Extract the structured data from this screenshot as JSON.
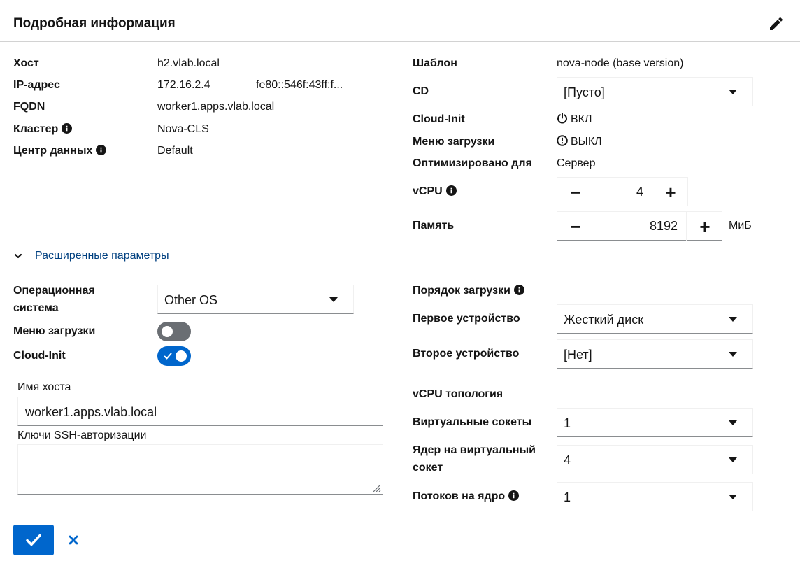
{
  "header": {
    "title": "Подробная информация",
    "edit_icon": "pencil-icon"
  },
  "left": {
    "host_label": "Хост",
    "host_value": "h2.vlab.local",
    "ip_label": "IP-адрес",
    "ip_v4": "172.16.2.4",
    "ip_v6": "fe80::546f:43ff:f...",
    "fqdn_label": "FQDN",
    "fqdn_value": "worker1.apps.vlab.local",
    "cluster_label": "Кластер",
    "cluster_value": "Nova-CLS",
    "dc_label": "Центр данных",
    "dc_value": "Default"
  },
  "right": {
    "template_label": "Шаблон",
    "template_value": "nova-node (base version)",
    "cd_label": "CD",
    "cd_value": "[Пусто]",
    "cloudinit_label": "Cloud-Init",
    "cloudinit_value": "ВКЛ",
    "bootmenu_label": "Меню загрузки",
    "bootmenu_value": "ВЫКЛ",
    "optimized_label": "Оптимизировано для",
    "optimized_value": "Сервер",
    "vcpu_label": "vCPU",
    "vcpu_value": "4",
    "memory_label": "Память",
    "memory_value": "8192",
    "memory_unit": "МиБ"
  },
  "advanced": {
    "toggle_label": "Расширенные параметры",
    "os_label_line1": "Операционная",
    "os_label_line2": "система",
    "os_value": "Other OS",
    "bootmenu_label": "Меню загрузки",
    "bootmenu_on": false,
    "cloudinit_label": "Cloud-Init",
    "cloudinit_on": true,
    "hostname_label": "Имя хоста",
    "hostname_value": "worker1.apps.vlab.local",
    "ssh_label": "Ключи SSH-авторизации",
    "ssh_value": "",
    "boot_order_label": "Порядок загрузки",
    "first_device_label": "Первое устройство",
    "first_device_value": "Жесткий диск",
    "second_device_label": "Второе устройство",
    "second_device_value": "[Нет]",
    "vcpu_topology_label": "vCPU топология",
    "sockets_label": "Виртуальные сокеты",
    "sockets_value": "1",
    "cores_label_line1": "Ядер на виртуальный",
    "cores_label_line2": "сокет",
    "cores_value": "4",
    "threads_label": "Потоков на ядро",
    "threads_value": "1"
  },
  "colors": {
    "primary": "#0066cc",
    "toggle_off": "#6a6e73",
    "link": "#004080"
  }
}
